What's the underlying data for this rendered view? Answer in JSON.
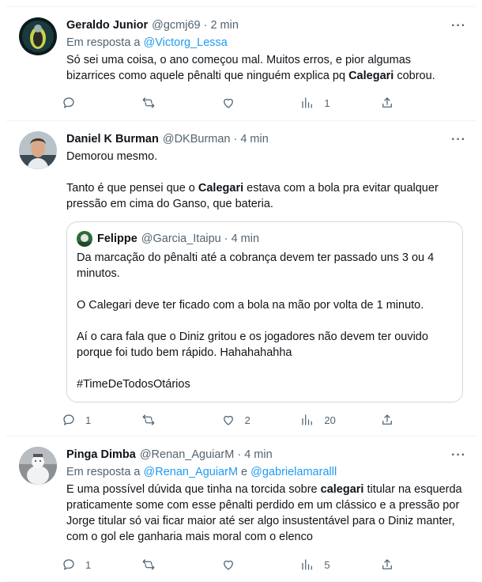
{
  "tweets": [
    {
      "name": "Geraldo Junior",
      "handle": "@gcmj69",
      "dot": "·",
      "time": "2 min",
      "reply_prefix": "Em resposta a ",
      "reply_to": "@Victorg_Lessa",
      "text_pre": "Só sei uma coisa, o ano começou mal. Muitos erros, e pior algumas bizarrices como aquele pênalti que ninguém explica pq ",
      "text_bold": "Calegari",
      "text_post": " cobrou.",
      "more": "···",
      "reply_count": "",
      "retweet_count": "",
      "like_count": "",
      "views_count": "1"
    },
    {
      "name": "Daniel K Burman",
      "handle": "@DKBurman",
      "dot": "·",
      "time": "4 min",
      "para1": "Demorou mesmo.",
      "para2_pre": "Tanto é que pensei que o ",
      "para2_bold": "Calegari",
      "para2_post": " estava com a bola pra evitar qualquer pressão em cima do Ganso, que bateria.",
      "more": "···",
      "quote": {
        "name": "Felippe",
        "handle": "@Garcia_Itaipu",
        "dot": "·",
        "time": "4 min",
        "paragraphs": [
          "Da marcação do pênalti até a cobrança devem ter passado uns 3 ou 4 minutos.",
          "O Calegari deve ter ficado com a bola na mão por volta de 1 minuto.",
          "Aí o cara fala que o Diniz gritou e os jogadores não devem ter ouvido porque foi tudo bem rápido. Hahahahahha",
          "#TimeDeTodosOtários"
        ]
      },
      "reply_count": "1",
      "retweet_count": "",
      "like_count": "2",
      "views_count": "20"
    },
    {
      "name": "Pinga Dimba",
      "handle": "@Renan_AguiarM",
      "dot": "·",
      "time": "4 min",
      "reply_prefix": "Em resposta a ",
      "reply_to_1": "@Renan_AguiarM",
      "reply_and": " e ",
      "reply_to_2": "@gabrielamaralll",
      "text_pre": "E uma possível dúvida que tinha na torcida sobre ",
      "text_bold": "calegari",
      "text_post": " titular na esquerda praticamente some com esse pênalti perdido em um clássico e a pressão por Jorge titular só vai ficar maior até ser algo insustentável para o Diniz manter, com o gol ele ganharia mais moral com o elenco",
      "more": "···",
      "reply_count": "1",
      "retweet_count": "",
      "like_count": "",
      "views_count": "5"
    }
  ],
  "icons": {
    "reply": "reply-icon",
    "retweet": "retweet-icon",
    "like": "like-icon",
    "views": "views-icon",
    "share": "share-icon",
    "more": "more-icon"
  },
  "colors": {
    "link": "#1d9bf0",
    "secondary_text": "#536471",
    "border": "#eff3f4",
    "quote_border": "#cfd9de"
  }
}
